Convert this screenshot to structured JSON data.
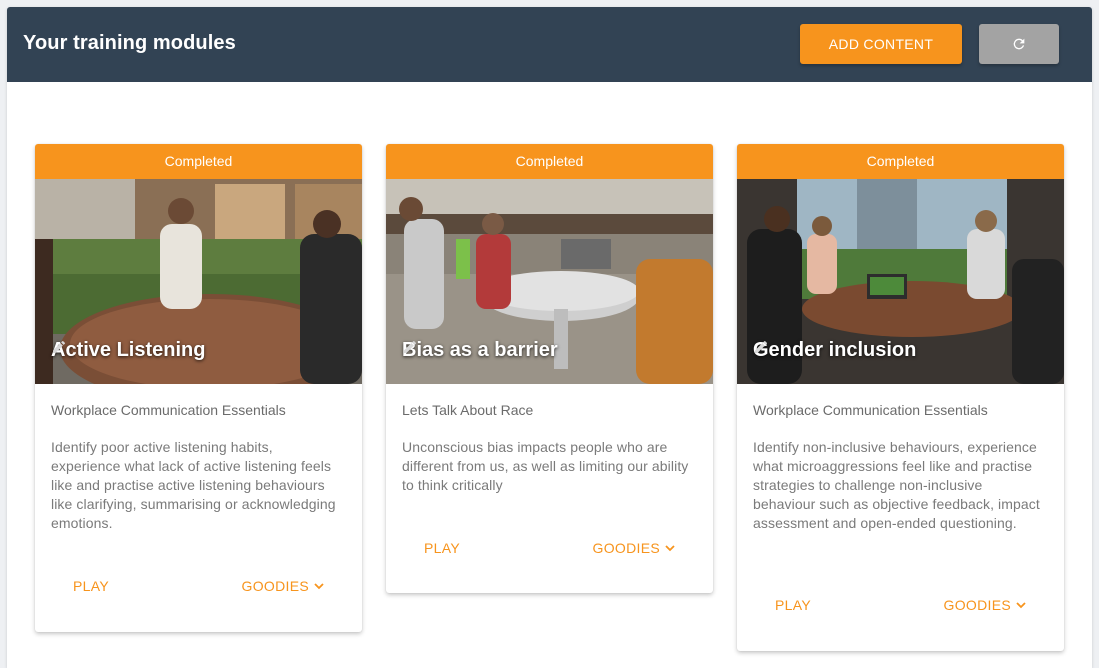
{
  "header": {
    "title": "Your training modules",
    "add_content_label": "ADD CONTENT",
    "refresh_icon": "refresh-icon"
  },
  "colors": {
    "header_bg": "#324354",
    "accent": "#f7941d",
    "refresh_bg": "#a3a3a3"
  },
  "modules": [
    {
      "status": "Completed",
      "title": "Active Listening",
      "course": "Workplace Communication Essentials",
      "description": "Identify poor active listening habits, experience what lack of active listening feels like and practise active listening behaviours like clarifying, summarising or acknowledging emotions.",
      "play_label": "PLAY",
      "goodies_label": "GOODIES"
    },
    {
      "status": "Completed",
      "title": "Bias as a barrier",
      "course": "Lets Talk About Race",
      "description": "Unconscious bias impacts people who are different from us, as well as limiting our ability to think critically",
      "play_label": "PLAY",
      "goodies_label": "GOODIES"
    },
    {
      "status": "Completed",
      "title": "Gender inclusion",
      "course": "Workplace Communication Essentials",
      "description": "Identify non-inclusive behaviours, experience what microaggressions feel like and practise strategies to challenge non-inclusive behaviour such as objective feedback, impact assessment and open-ended questioning.",
      "play_label": "PLAY",
      "goodies_label": "GOODIES"
    }
  ]
}
